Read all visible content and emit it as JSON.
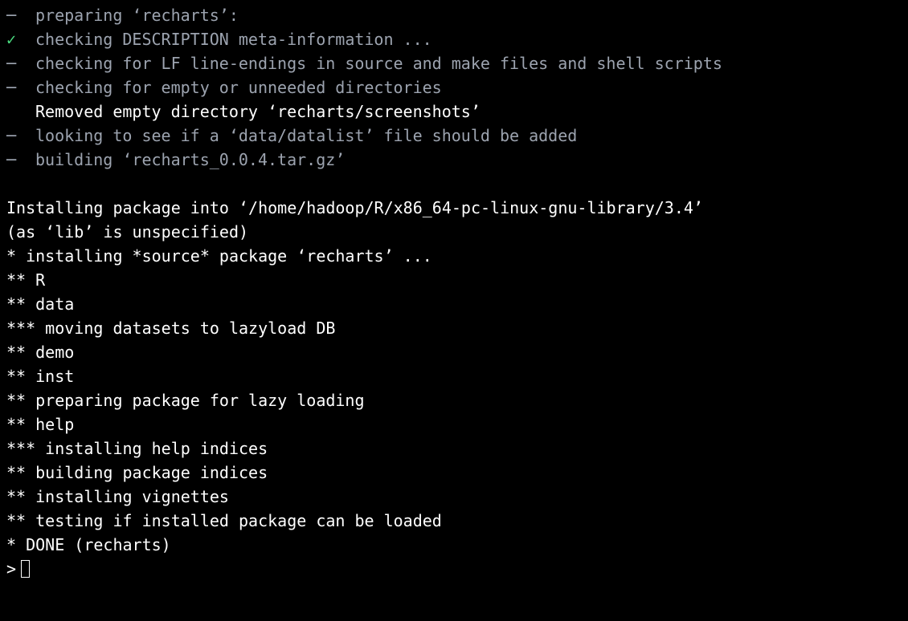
{
  "build_steps": [
    {
      "bullet": "dash",
      "text": "preparing ‘recharts’:",
      "style": "dim"
    },
    {
      "bullet": "check",
      "text": "checking DESCRIPTION meta-information ...",
      "style": "dim"
    },
    {
      "bullet": "dash",
      "text": "checking for LF line-endings in source and make files and shell scripts",
      "style": "dim"
    },
    {
      "bullet": "dash",
      "text": "checking for empty or unneeded directories",
      "style": "dim"
    },
    {
      "bullet": "none",
      "text": "Removed empty directory ‘recharts/screenshots’",
      "style": "white"
    },
    {
      "bullet": "dash",
      "text": "looking to see if a ‘data/datalist’ file should be added",
      "style": "dim"
    },
    {
      "bullet": "dash",
      "text": "building ‘recharts_0.0.4.tar.gz’",
      "style": "dim"
    }
  ],
  "install_lines": [
    "Installing package into ‘/home/hadoop/R/x86_64-pc-linux-gnu-library/3.4’",
    "(as ‘lib’ is unspecified)",
    "* installing *source* package ‘recharts’ ...",
    "** R",
    "** data",
    "*** moving datasets to lazyload DB",
    "** demo",
    "** inst",
    "** preparing package for lazy loading",
    "** help",
    "*** installing help indices",
    "** building package indices",
    "** installing vignettes",
    "** testing if installed package can be loaded",
    "* DONE (recharts)"
  ],
  "prompt": ">",
  "bullets": {
    "dash": "─",
    "check": "✓",
    "none": ""
  }
}
